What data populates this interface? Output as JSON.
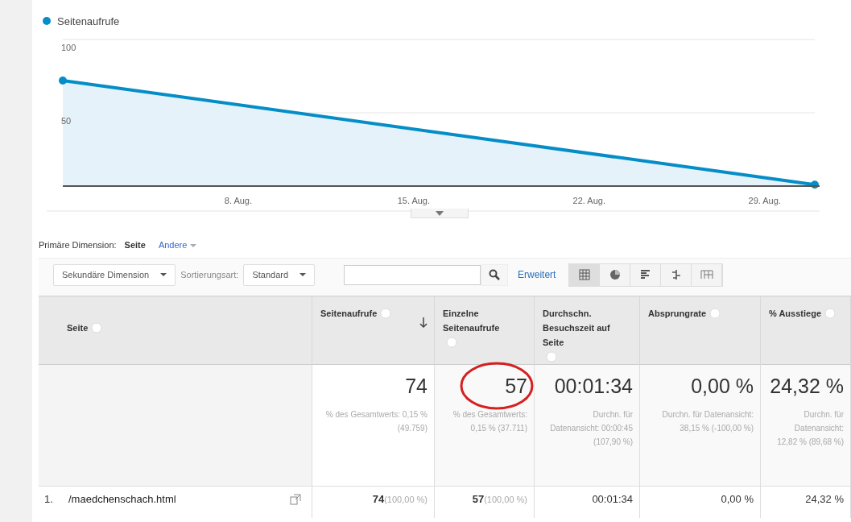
{
  "chart": {
    "chart_data": {
      "type": "area",
      "ylim": [
        0,
        100
      ],
      "yticks": [
        50,
        100
      ],
      "categories": [
        null,
        null,
        null,
        null,
        null,
        null,
        null,
        "8. Aug.",
        null,
        null,
        null,
        null,
        null,
        null,
        "15. Aug.",
        null,
        null,
        null,
        null,
        null,
        null,
        "22. Aug.",
        null,
        null,
        null,
        null,
        null,
        null,
        "29. Aug.",
        null,
        null
      ],
      "series": [
        {
          "name": "Seitenaufrufe",
          "color": "#058dc7",
          "values": [
            72,
            null,
            null,
            null,
            null,
            null,
            null,
            null,
            null,
            null,
            null,
            null,
            null,
            null,
            null,
            null,
            null,
            null,
            null,
            null,
            null,
            null,
            null,
            null,
            null,
            null,
            null,
            null,
            null,
            null,
            1
          ]
        }
      ]
    }
  },
  "dimension": {
    "label": "Primäre Dimension:",
    "items": [
      {
        "label": "Seite",
        "selected": true
      },
      {
        "label": "Andere",
        "selected": false
      }
    ]
  },
  "toolbar": {
    "secondary": "Sekundäre Dimension",
    "sort_label": "Sortierungsart:",
    "sort": "Standard",
    "advanced": "Erweitert",
    "views": [
      {
        "kind": "table",
        "selected": true
      },
      {
        "kind": "pie",
        "selected": false
      },
      {
        "kind": "bars",
        "selected": false
      },
      {
        "kind": "compare",
        "selected": false
      },
      {
        "kind": "pivot",
        "selected": false
      }
    ]
  },
  "table": {
    "columns": [
      {
        "label": "Seite",
        "sorted": false
      },
      {
        "label": "Seitenaufrufe",
        "sorted": true
      },
      {
        "label": "Einzelne Seitenaufrufe",
        "sorted": false
      },
      {
        "label": "Durchschn. Besuchszeit auf Seite",
        "sorted": false
      },
      {
        "label": "Absprungrate",
        "sorted": false
      },
      {
        "label": "% Ausstiege",
        "sorted": false
      }
    ],
    "summary": [
      {
        "value": "74",
        "note": "% des Gesamtwerts: 0,15 % (49.759)"
      },
      {
        "value": "57",
        "note": "% des Gesamtwerts: 0,15 % (37.711)",
        "highlighted": true
      },
      {
        "value": "00:01:34",
        "note": "Durchn. für Datenansicht: 00:00:45 (107,90 %)"
      },
      {
        "value": "0,00 %",
        "note": "Durchn. für Datenansicht: 38,15 % (-100,00 %)"
      },
      {
        "value": "24,32 %",
        "note": "Durchn. für Datenansicht: 12,82 % (89,68 %)"
      }
    ],
    "rows": [
      {
        "cells": [
          {
            "index": "1.",
            "value": "/maedchenschach.html"
          },
          {
            "value": "74",
            "share": "(100,00 %)"
          },
          {
            "value": "57",
            "share": "(100,00 %)"
          },
          {
            "value": "00:01:34"
          },
          {
            "value": "0,00 %"
          },
          {
            "value": "24,32 %"
          }
        ]
      }
    ]
  }
}
